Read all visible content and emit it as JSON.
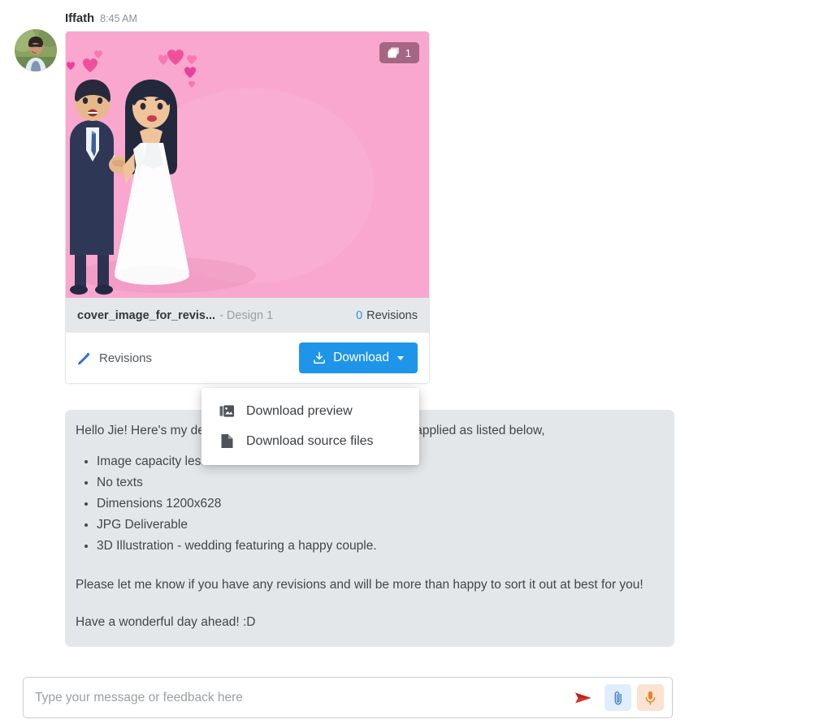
{
  "message": {
    "author": "Iffath",
    "time": "8:45 AM",
    "avatar_icon": "user-photo-avatar"
  },
  "attachment_card": {
    "preview_icon": "wedding-couple-3d-illustration",
    "stack_badge": {
      "icon": "layers-icon",
      "count": "1"
    },
    "file_name": "cover_image_for_revis...",
    "design_label": "- Design 1",
    "revisions_count": "0",
    "revisions_word": "Revisions",
    "revisions_link_label": "Revisions",
    "revisions_icon": "pencil-icon",
    "download_button_label": "Download",
    "download_icon": "download-icon",
    "caret_icon": "caret-down-icon"
  },
  "download_menu": {
    "items": [
      {
        "label": "Download preview",
        "icon": "image-icon"
      },
      {
        "label": "Download source files",
        "icon": "file-icon"
      }
    ]
  },
  "message_body": {
    "greeting": "Hello Jie! Here's my design for you with all the specifications applied as listed below,",
    "specs": [
      "Image capacity less than 100kb",
      "No texts",
      "Dimensions 1200x628",
      "JPG Deliverable",
      "3D Illustration - wedding featuring a happy couple."
    ],
    "closing": "Please let me know if you have any revisions and will be more than happy to sort it out at best for you!",
    "signoff": "Have a wonderful day ahead! :D"
  },
  "composer": {
    "placeholder": "Type your message or feedback here",
    "value": "",
    "send_icon": "send-arrow-icon",
    "attach_icon": "paperclip-icon",
    "mic_icon": "microphone-icon"
  },
  "colors": {
    "accent_blue": "#1e95e8",
    "bubble_bg": "#e3e7ea",
    "file_strip_bg": "#e5e8ea",
    "preview_pink": "#f9a7ce",
    "send_red": "#d8302a",
    "mic_orange": "#e8851f",
    "revision_blue": "#2d8fe0"
  }
}
